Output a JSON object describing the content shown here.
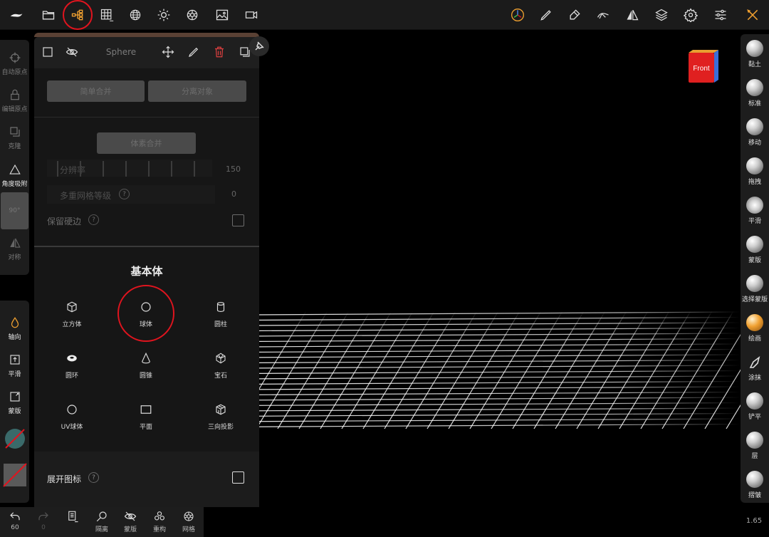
{
  "panel": {
    "title": "Sphere",
    "buttons": {
      "merge": "简单合并",
      "split": "分离对象",
      "voxel_merge": "体素合并"
    },
    "rows": {
      "resolution": {
        "label": "分辨率",
        "value": "150"
      },
      "multires": {
        "label": "多重网格等级",
        "value": "0"
      },
      "keep_sharp": {
        "label": "保留硬边"
      }
    },
    "section_title": "基本体",
    "primitives": [
      {
        "label": "立方体",
        "icon": "cube-icon"
      },
      {
        "label": "球体",
        "icon": "sphere-icon"
      },
      {
        "label": "圆柱",
        "icon": "cylinder-icon"
      },
      {
        "label": "圆环",
        "icon": "torus-icon"
      },
      {
        "label": "圆锥",
        "icon": "cone-icon"
      },
      {
        "label": "宝石",
        "icon": "gem-icon"
      },
      {
        "label": "UV球体",
        "icon": "uv-sphere-icon"
      },
      {
        "label": "平面",
        "icon": "plane-icon"
      },
      {
        "label": "三向投影",
        "icon": "triplanar-icon"
      }
    ],
    "expand_label": "展开图标",
    "help_glyph": "?"
  },
  "left_tools": [
    {
      "label": "自动原点",
      "icon": "crosshair-icon"
    },
    {
      "label": "编辑原点",
      "icon": "lock-icon"
    },
    {
      "label": "克隆",
      "icon": "clone-icon"
    },
    {
      "label": "角度吸附",
      "icon": "angle-icon"
    },
    {
      "label": "90°",
      "icon": ""
    },
    {
      "label": "对称",
      "icon": "symmetry-icon"
    }
  ],
  "left_tools_lower": [
    {
      "label": "轴向",
      "icon": "drop-icon"
    },
    {
      "label": "平滑",
      "icon": "smooth-icon"
    },
    {
      "label": "蒙版",
      "icon": "mask-icon"
    }
  ],
  "bottom_bar": [
    {
      "label": "60",
      "icon": "undo-icon"
    },
    {
      "label": "0",
      "icon": "redo-icon"
    },
    {
      "label": "",
      "icon": "scene-icon"
    },
    {
      "label": "隔离",
      "icon": "isolate-icon"
    },
    {
      "label": "蒙版",
      "icon": "hide-icon"
    },
    {
      "label": "重构",
      "icon": "remesh-icon"
    },
    {
      "label": "网格",
      "icon": "wireframe-icon"
    }
  ],
  "right_brushes": [
    "黏土",
    "标准",
    "移动",
    "拖拽",
    "平滑",
    "蒙版",
    "选择蒙版",
    "绘画",
    "涂抹",
    "铲平",
    "层",
    "摺皱"
  ],
  "view_cube_label": "Front",
  "zoom_value": "1.65",
  "colors": {
    "accent_red": "#e0141e",
    "panel_bg": "#161616",
    "toolbar_bg": "#1b1b1b",
    "panel_strip": "#5a4134",
    "orange_brush": "#f0a030"
  }
}
